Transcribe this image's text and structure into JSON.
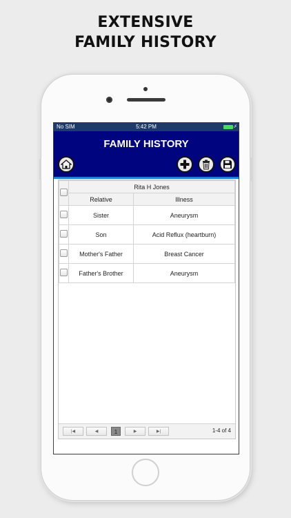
{
  "promo": {
    "line1": "EXTENSIVE",
    "line2": "FAMILY HISTORY"
  },
  "status_bar": {
    "carrier": "No SIM",
    "time": "5:42 PM"
  },
  "header": {
    "title": "FAMILY HISTORY"
  },
  "grid": {
    "patient_name": "Rita H Jones",
    "columns": [
      "Relative",
      "Illness"
    ],
    "rows": [
      {
        "relative": "Sister",
        "illness": "Aneurysm"
      },
      {
        "relative": "Son",
        "illness": "Acid Reflux (heartburn)"
      },
      {
        "relative": "Mother's Father",
        "illness": "Breast Cancer"
      },
      {
        "relative": "Father's Brother",
        "illness": "Aneurysm"
      }
    ]
  },
  "pager": {
    "current_page": "1",
    "info": "1-4 of 4"
  },
  "colors": {
    "header_bg": "#00047e",
    "header_border": "#1f7fd8",
    "status_bg": "#1d3a6a"
  },
  "icons": [
    "home-icon",
    "plus-icon",
    "trash-icon",
    "floppy-disk-icon",
    "first-page-icon",
    "prev-page-icon",
    "next-page-icon",
    "last-page-icon"
  ]
}
